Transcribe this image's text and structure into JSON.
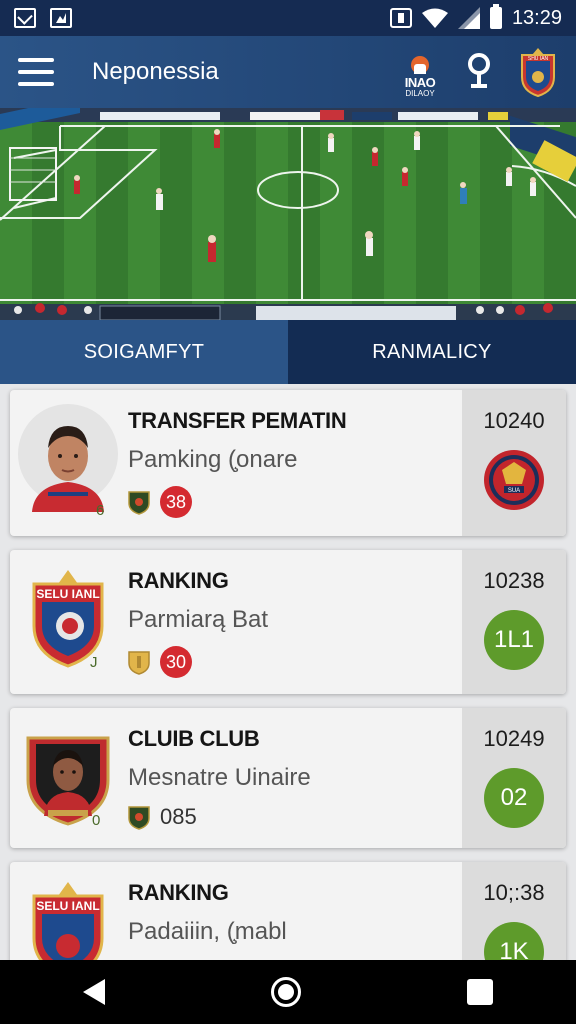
{
  "status_bar": {
    "time": "13:29"
  },
  "app_bar": {
    "title": "Neponessia",
    "brand_line1": "INAO",
    "brand_line2": "DILAOY",
    "crest_text": "SHU IAN"
  },
  "tabs": [
    {
      "label": "SOIGAMFYT",
      "active": true
    },
    {
      "label": "RANMALICY",
      "active": false
    }
  ],
  "cards": [
    {
      "title": "TRANSFER PEMATIN",
      "subtitle": "Pamking (̧onare",
      "score": "10240",
      "badge": "38",
      "corner": "6",
      "side_type": "crest",
      "side_crest_text": "SUA"
    },
    {
      "title": "RANKING",
      "subtitle": "Parmiarą Bat",
      "score": "10238",
      "badge": "30",
      "corner": "J",
      "side_type": "green",
      "side_badge": "1L1",
      "crest_text": "SELU IANL"
    },
    {
      "title": "CLUIB CLUB",
      "subtitle": "Mesnatre Uinaire",
      "score": "10249",
      "meta_text": "085",
      "corner": "0",
      "side_type": "green",
      "side_badge": "02"
    },
    {
      "title": "RANKING",
      "subtitle": "Padaiiin, (̧mabl",
      "score": "10;:38",
      "side_type": "green",
      "side_badge": "1K",
      "crest_text": "SELU IANL"
    }
  ],
  "colors": {
    "status_bg": "#152b52",
    "appbar": "#2b5487",
    "tab_active": "#2b5487",
    "tab_inactive": "#132c53",
    "badge_red": "#d42a30",
    "badge_green": "#5e9b2b"
  }
}
